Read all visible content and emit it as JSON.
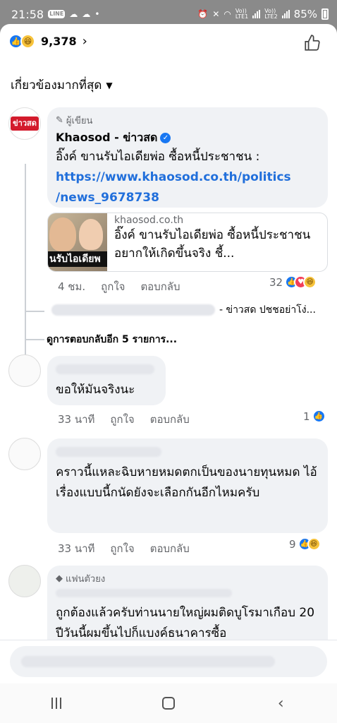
{
  "status_bar": {
    "time": "21:58",
    "line_badge": "LINE",
    "battery": "85%",
    "volte1": "Vo))",
    "lte1": "LTE1",
    "volte2": "Vo))",
    "lte2": "LTE2"
  },
  "header": {
    "reaction_count": "9,378",
    "sort_label": "เกี่ยวข้องมากที่สุด"
  },
  "colors": {
    "accent": "#1877f2",
    "link": "#216fdb",
    "brand": "#d31b2c"
  },
  "comments": [
    {
      "badge": "ผู้เขียน",
      "author": "Khaosod - ข่าวสด",
      "avatar_text": "ข่าวสด",
      "text": "อิ๊งค์ ขานรับไอเดียพ่อ ซื้อหนี้ประชาชน :",
      "link_line1": "https://www.khaosod.co.th/politics",
      "link_line2": "/news_9678738",
      "link_card": {
        "domain": "khaosod.co.th",
        "title": "อิ๊งค์ ขานรับไอเดียพ่อ ซื้อหนี้ประชาชน อยากให้เกิดขึ้นจริง ชี้...",
        "thumb_text": "นรับไอเดียพ"
      },
      "time": "4 ชม.",
      "like": "ถูกใจ",
      "reply": "ตอบกลับ",
      "reactions": "32",
      "reply_preview": "- ข่าวสด ปชชอย่าโง่...",
      "more_replies": "ดูการตอบกลับอีก 5 รายการ..."
    },
    {
      "text": "ขอให้มันจริงนะ",
      "time": "33 นาที",
      "like": "ถูกใจ",
      "reply": "ตอบกลับ",
      "reactions": "1"
    },
    {
      "text": "คราวนี้แหละฉิบหายหมดตกเป็นของนายทุนหมด ไอ้เรื่องแบบนี้กนัดยังจะเลือกกันอีกไหมครับ",
      "time": "33 นาที",
      "like": "ถูกใจ",
      "reply": "ตอบกลับ",
      "reactions": "9"
    },
    {
      "badge": "แฟนตัวยง",
      "text": "ถูกต้องแล้วครับท่านนายใหญ่ผมติดบูโรมาเกือบ 20 ปีวันนี้ผมขึ้นไปก็แบงค์ธนาคารซื้อ"
    }
  ]
}
